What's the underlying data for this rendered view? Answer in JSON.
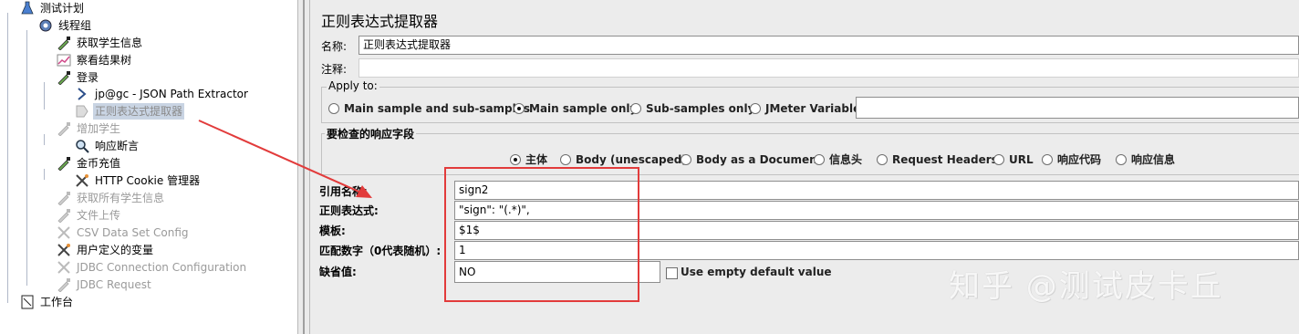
{
  "tree": {
    "items": [
      {
        "label": "测试计划",
        "icon": "flask-icon"
      },
      {
        "label": "线程组",
        "icon": "gear-icon"
      },
      {
        "label": "获取学生信息",
        "icon": "pipette-icon"
      },
      {
        "label": "察看结果树",
        "icon": "chart-icon"
      },
      {
        "label": "登录",
        "icon": "pipette-icon"
      },
      {
        "label": "jp@gc - JSON Path Extractor",
        "icon": "arrow-icon"
      },
      {
        "label": "正则表达式提取器",
        "icon": "document-icon"
      },
      {
        "label": "增加学生",
        "icon": "pipette-icon"
      },
      {
        "label": "响应断言",
        "icon": "magnifier-icon"
      },
      {
        "label": "金币充值",
        "icon": "pipette-icon"
      },
      {
        "label": "HTTP Cookie 管理器",
        "icon": "tools-icon"
      },
      {
        "label": "获取所有学生信息",
        "icon": "pipette-icon"
      },
      {
        "label": "文件上传",
        "icon": "pipette-icon"
      },
      {
        "label": "CSV Data Set Config",
        "icon": "tools-icon"
      },
      {
        "label": "用户定义的变量",
        "icon": "tools-icon"
      },
      {
        "label": "JDBC Connection Configuration",
        "icon": "tools-icon"
      },
      {
        "label": "JDBC Request",
        "icon": "pipette-icon"
      },
      {
        "label": "工作台",
        "icon": "workbench-icon"
      }
    ]
  },
  "panel": {
    "title": "正则表达式提取器",
    "name_label": "名称:",
    "name_value": "正则表达式提取器",
    "comment_label": "注释:",
    "comment_value": "",
    "apply_to": {
      "label": "Apply to:",
      "options": [
        "Main sample and sub-samples",
        "Main sample only",
        "Sub-samples only",
        "JMeter Variable"
      ],
      "selected": "Main sample only",
      "variable_value": ""
    },
    "field_group": {
      "label": "要检查的响应字段",
      "options": [
        "主体",
        "Body (unescaped)",
        "Body as a Document",
        "信息头",
        "Request Headers",
        "URL",
        "响应代码",
        "响应信息"
      ],
      "selected": "主体"
    },
    "ref_name_label": "引用名称:",
    "ref_name_value": "sign2",
    "regex_label": "正则表达式:",
    "regex_value": "\"sign\": \"(.*)\",",
    "template_label": "模板:",
    "template_value": "$1$",
    "match_no_label": "匹配数字（0代表随机）:",
    "match_no_value": "1",
    "default_label": "缺省值:",
    "default_value": "NO",
    "empty_default_label": "Use empty default value",
    "empty_default_checked": false
  },
  "watermark": "知乎 @测试皮卡丘",
  "colors": {
    "annotation_red": "#e23b3b",
    "selection": "#c9d4e3",
    "disabled_text": "#9a9a9a"
  }
}
